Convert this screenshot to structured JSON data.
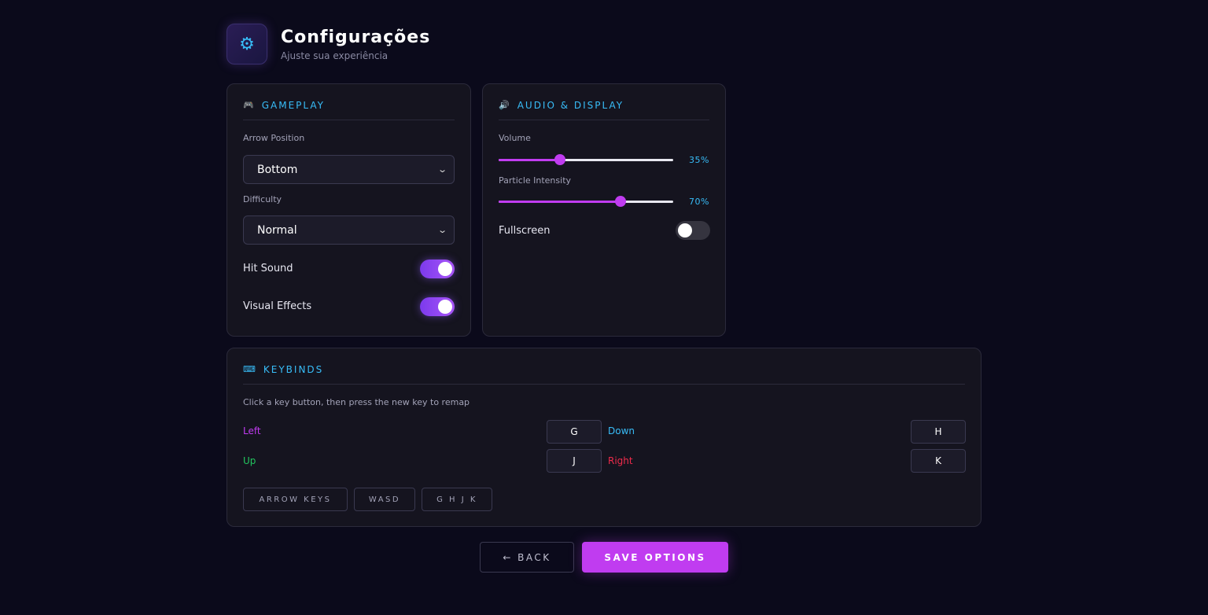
{
  "header": {
    "icon": "gear-icon",
    "title": "Configurações",
    "subtitle": "Ajuste sua experiência"
  },
  "gameplay": {
    "icon": "gamepad-icon",
    "title": "GAMEPLAY",
    "arrow_position_label": "Arrow Position",
    "arrow_position_value": "Bottom",
    "difficulty_label": "Difficulty",
    "difficulty_value": "Normal",
    "hit_sound_label": "Hit Sound",
    "hit_sound_on": true,
    "visual_effects_label": "Visual Effects",
    "visual_effects_on": true
  },
  "audio": {
    "icon": "speaker-icon",
    "title": "AUDIO & DISPLAY",
    "volume_label": "Volume",
    "volume_value": 35,
    "volume_text": "35%",
    "particle_label": "Particle Intensity",
    "particle_value": 70,
    "particle_text": "70%",
    "fullscreen_label": "Fullscreen",
    "fullscreen_on": false
  },
  "keybinds": {
    "icon": "keyboard-icon",
    "title": "KEYBINDS",
    "hint": "Click a key button, then press the new key to remap",
    "left_label": "Left",
    "left_key": "G",
    "down_label": "Down",
    "down_key": "H",
    "up_label": "Up",
    "up_key": "J",
    "right_label": "Right",
    "right_key": "K",
    "presets": [
      "ARROW KEYS",
      "WASD",
      "G H J K"
    ]
  },
  "actions": {
    "back_label": "← BACK",
    "save_label": "SAVE OPTIONS"
  },
  "colors": {
    "accent": "#c03cf0",
    "secondary": "#38bdf8",
    "left": "#c03cf0",
    "down": "#38bdf8",
    "up": "#22c55e",
    "right": "#ef2b4b"
  }
}
